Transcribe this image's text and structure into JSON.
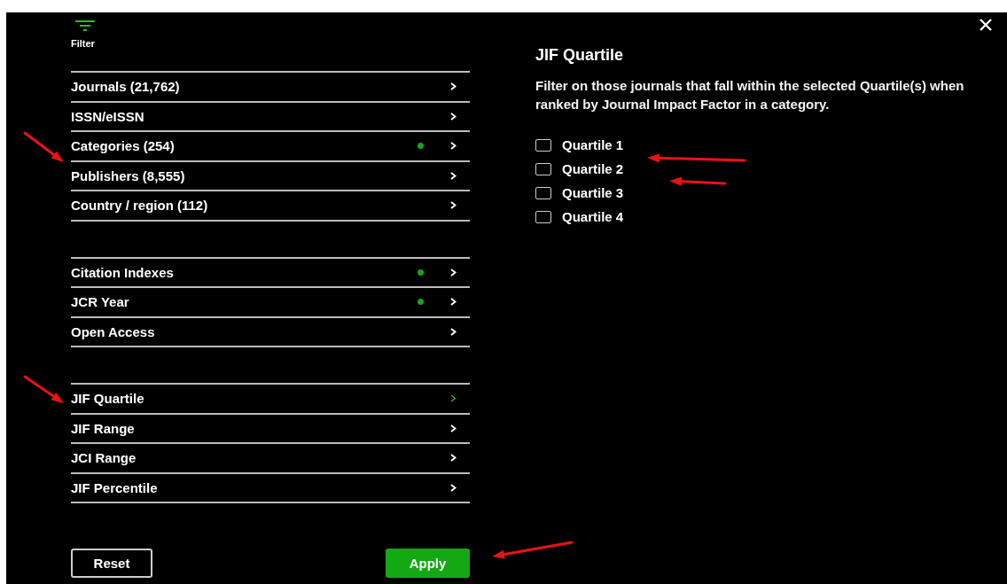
{
  "toolbar": {
    "label": "Filter"
  },
  "filter_groups": [
    [
      {
        "label": "Journals (21,762)",
        "active": false,
        "selected": false
      },
      {
        "label": "ISSN/eISSN",
        "active": false,
        "selected": false
      },
      {
        "label": "Categories (254)",
        "active": true,
        "selected": false
      },
      {
        "label": "Publishers (8,555)",
        "active": false,
        "selected": false
      },
      {
        "label": "Country / region (112)",
        "active": false,
        "selected": false
      }
    ],
    [
      {
        "label": "Citation Indexes",
        "active": true,
        "selected": false
      },
      {
        "label": "JCR Year",
        "active": true,
        "selected": false
      },
      {
        "label": "Open Access",
        "active": false,
        "selected": false
      }
    ],
    [
      {
        "label": "JIF Quartile",
        "active": false,
        "selected": true
      },
      {
        "label": "JIF Range",
        "active": false,
        "selected": false
      },
      {
        "label": "JCI Range",
        "active": false,
        "selected": false
      },
      {
        "label": "JIF Percentile",
        "active": false,
        "selected": false
      }
    ]
  ],
  "detail": {
    "title": "JIF Quartile",
    "description": "Filter on those journals that fall within the selected Quartile(s) when ranked by Journal Impact Factor in a category.",
    "options": [
      {
        "label": "Quartile 1",
        "checked": false
      },
      {
        "label": "Quartile 2",
        "checked": false
      },
      {
        "label": "Quartile 3",
        "checked": false
      },
      {
        "label": "Quartile 4",
        "checked": false
      }
    ]
  },
  "buttons": {
    "reset": "Reset",
    "apply": "Apply"
  }
}
